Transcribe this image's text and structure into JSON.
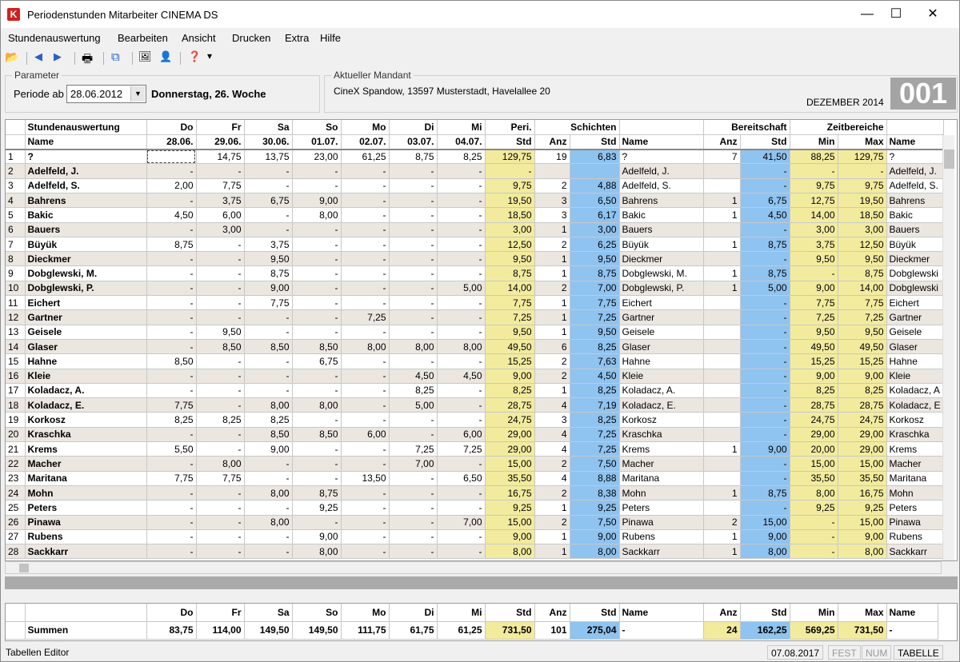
{
  "window": {
    "title": "Periodenstunden Mitarbeiter CINEMA DS",
    "app_icon": "K",
    "minimize": "—",
    "maximize": "☐",
    "close": "✕"
  },
  "menu": [
    "Stundenauswertung",
    "Bearbeiten",
    "Ansicht",
    "Drucken",
    "Extra",
    "Hilfe"
  ],
  "toolbar": [
    {
      "name": "open-folder-icon",
      "glyph": "📂"
    },
    {
      "name": "back-arrow-icon",
      "glyph": "◀"
    },
    {
      "name": "forward-arrow-icon",
      "glyph": "▶"
    },
    {
      "name": "print-icon",
      "glyph": "🖶"
    },
    {
      "name": "copy-icon",
      "glyph": "⧉"
    },
    {
      "name": "picture-icon",
      "glyph": "🖼"
    },
    {
      "name": "user-icon",
      "glyph": "👤"
    },
    {
      "name": "help-icon",
      "glyph": "❓"
    },
    {
      "name": "dropdown-arrow-icon",
      "glyph": "▾"
    }
  ],
  "parameter": {
    "legend": "Parameter",
    "periode_label": "Periode ab",
    "periode_value": "28.06.2012",
    "periode_info": "Donnerstag, 26. Woche"
  },
  "mandant": {
    "legend": "Aktueller Mandant",
    "address": "CineX Spandow, 13597 Musterstadt, Havelallee 20",
    "month": "DEZEMBER 2014",
    "number": "001"
  },
  "grid": {
    "group_headers": [
      "Stundenauswertung",
      "Do",
      "Fr",
      "Sa",
      "So",
      "Mo",
      "Di",
      "Mi",
      "Peri.",
      "Schichten",
      "",
      "Bereitschaft",
      "Zeitbereiche",
      ""
    ],
    "columns": [
      "",
      "Name",
      "28.06.",
      "29.06.",
      "30.06.",
      "01.07.",
      "02.07.",
      "03.07.",
      "04.07.",
      "Std",
      "Anz",
      "Std",
      "Name",
      "Anz",
      "Std",
      "Min",
      "Max",
      "Name"
    ],
    "rows": [
      [
        "1",
        "?",
        "",
        "14,75",
        "13,75",
        "23,00",
        "61,25",
        "8,75",
        "8,25",
        "129,75",
        "19",
        "6,83",
        "?",
        "7",
        "41,50",
        "88,25",
        "129,75",
        "?"
      ],
      [
        "2",
        "Adelfeld, J.",
        "-",
        "-",
        "-",
        "-",
        "-",
        "-",
        "-",
        "-",
        "",
        "",
        "Adelfeld, J.",
        "",
        "-",
        "-",
        "-",
        "Adelfeld, J."
      ],
      [
        "3",
        "Adelfeld, S.",
        "2,00",
        "7,75",
        "-",
        "-",
        "-",
        "-",
        "-",
        "9,75",
        "2",
        "4,88",
        "Adelfeld, S.",
        "",
        "-",
        "9,75",
        "9,75",
        "Adelfeld, S."
      ],
      [
        "4",
        "Bahrens",
        "-",
        "3,75",
        "6,75",
        "9,00",
        "-",
        "-",
        "-",
        "19,50",
        "3",
        "6,50",
        "Bahrens",
        "1",
        "6,75",
        "12,75",
        "19,50",
        "Bahrens"
      ],
      [
        "5",
        "Bakic",
        "4,50",
        "6,00",
        "-",
        "8,00",
        "-",
        "-",
        "-",
        "18,50",
        "3",
        "6,17",
        "Bakic",
        "1",
        "4,50",
        "14,00",
        "18,50",
        "Bakic"
      ],
      [
        "6",
        "Bauers",
        "-",
        "3,00",
        "-",
        "-",
        "-",
        "-",
        "-",
        "3,00",
        "1",
        "3,00",
        "Bauers",
        "",
        "-",
        "3,00",
        "3,00",
        "Bauers"
      ],
      [
        "7",
        "Büyük",
        "8,75",
        "-",
        "3,75",
        "-",
        "-",
        "-",
        "-",
        "12,50",
        "2",
        "6,25",
        "Büyük",
        "1",
        "8,75",
        "3,75",
        "12,50",
        "Büyük"
      ],
      [
        "8",
        "Dieckmer",
        "-",
        "-",
        "9,50",
        "-",
        "-",
        "-",
        "-",
        "9,50",
        "1",
        "9,50",
        "Dieckmer",
        "",
        "-",
        "9,50",
        "9,50",
        "Dieckmer"
      ],
      [
        "9",
        "Dobglewski, M.",
        "-",
        "-",
        "8,75",
        "-",
        "-",
        "-",
        "-",
        "8,75",
        "1",
        "8,75",
        "Dobglewski, M.",
        "1",
        "8,75",
        "-",
        "8,75",
        "Dobglewski"
      ],
      [
        "10",
        "Dobglewski, P.",
        "-",
        "-",
        "9,00",
        "-",
        "-",
        "-",
        "5,00",
        "14,00",
        "2",
        "7,00",
        "Dobglewski, P.",
        "1",
        "5,00",
        "9,00",
        "14,00",
        "Dobglewski"
      ],
      [
        "11",
        "Eichert",
        "-",
        "-",
        "7,75",
        "-",
        "-",
        "-",
        "-",
        "7,75",
        "1",
        "7,75",
        "Eichert",
        "",
        "-",
        "7,75",
        "7,75",
        "Eichert"
      ],
      [
        "12",
        "Gartner",
        "-",
        "-",
        "-",
        "-",
        "7,25",
        "-",
        "-",
        "7,25",
        "1",
        "7,25",
        "Gartner",
        "",
        "-",
        "7,25",
        "7,25",
        "Gartner"
      ],
      [
        "13",
        "Geisele",
        "-",
        "9,50",
        "-",
        "-",
        "-",
        "-",
        "-",
        "9,50",
        "1",
        "9,50",
        "Geisele",
        "",
        "-",
        "9,50",
        "9,50",
        "Geisele"
      ],
      [
        "14",
        "Glaser",
        "-",
        "8,50",
        "8,50",
        "8,50",
        "8,00",
        "8,00",
        "8,00",
        "49,50",
        "6",
        "8,25",
        "Glaser",
        "",
        "-",
        "49,50",
        "49,50",
        "Glaser"
      ],
      [
        "15",
        "Hahne",
        "8,50",
        "-",
        "-",
        "6,75",
        "-",
        "-",
        "-",
        "15,25",
        "2",
        "7,63",
        "Hahne",
        "",
        "-",
        "15,25",
        "15,25",
        "Hahne"
      ],
      [
        "16",
        "Kleie",
        "-",
        "-",
        "-",
        "-",
        "-",
        "4,50",
        "4,50",
        "9,00",
        "2",
        "4,50",
        "Kleie",
        "",
        "-",
        "9,00",
        "9,00",
        "Kleie"
      ],
      [
        "17",
        "Koladacz, A.",
        "-",
        "-",
        "-",
        "-",
        "-",
        "8,25",
        "-",
        "8,25",
        "1",
        "8,25",
        "Koladacz, A.",
        "",
        "-",
        "8,25",
        "8,25",
        "Koladacz, A"
      ],
      [
        "18",
        "Koladacz, E.",
        "7,75",
        "-",
        "8,00",
        "8,00",
        "-",
        "5,00",
        "-",
        "28,75",
        "4",
        "7,19",
        "Koladacz, E.",
        "",
        "-",
        "28,75",
        "28,75",
        "Koladacz, E"
      ],
      [
        "19",
        "Korkosz",
        "8,25",
        "8,25",
        "8,25",
        "-",
        "-",
        "-",
        "-",
        "24,75",
        "3",
        "8,25",
        "Korkosz",
        "",
        "-",
        "24,75",
        "24,75",
        "Korkosz"
      ],
      [
        "20",
        "Kraschka",
        "-",
        "-",
        "8,50",
        "8,50",
        "6,00",
        "-",
        "6,00",
        "29,00",
        "4",
        "7,25",
        "Kraschka",
        "",
        "-",
        "29,00",
        "29,00",
        "Kraschka"
      ],
      [
        "21",
        "Krems",
        "5,50",
        "-",
        "9,00",
        "-",
        "-",
        "7,25",
        "7,25",
        "29,00",
        "4",
        "7,25",
        "Krems",
        "1",
        "9,00",
        "20,00",
        "29,00",
        "Krems"
      ],
      [
        "22",
        "Macher",
        "-",
        "8,00",
        "-",
        "-",
        "-",
        "7,00",
        "-",
        "15,00",
        "2",
        "7,50",
        "Macher",
        "",
        "-",
        "15,00",
        "15,00",
        "Macher"
      ],
      [
        "23",
        "Maritana",
        "7,75",
        "7,75",
        "-",
        "-",
        "13,50",
        "-",
        "6,50",
        "35,50",
        "4",
        "8,88",
        "Maritana",
        "",
        "-",
        "35,50",
        "35,50",
        "Maritana"
      ],
      [
        "24",
        "Mohn",
        "-",
        "-",
        "8,00",
        "8,75",
        "-",
        "-",
        "-",
        "16,75",
        "2",
        "8,38",
        "Mohn",
        "1",
        "8,75",
        "8,00",
        "16,75",
        "Mohn"
      ],
      [
        "25",
        "Peters",
        "-",
        "-",
        "-",
        "9,25",
        "-",
        "-",
        "-",
        "9,25",
        "1",
        "9,25",
        "Peters",
        "",
        "-",
        "9,25",
        "9,25",
        "Peters"
      ],
      [
        "26",
        "Pinawa",
        "-",
        "-",
        "8,00",
        "-",
        "-",
        "-",
        "7,00",
        "15,00",
        "2",
        "7,50",
        "Pinawa",
        "2",
        "15,00",
        "-",
        "15,00",
        "Pinawa"
      ],
      [
        "27",
        "Rubens",
        "-",
        "-",
        "-",
        "9,00",
        "-",
        "-",
        "-",
        "9,00",
        "1",
        "9,00",
        "Rubens",
        "1",
        "9,00",
        "-",
        "9,00",
        "Rubens"
      ],
      [
        "28",
        "Sackkarr",
        "-",
        "-",
        "-",
        "8,00",
        "-",
        "-",
        "-",
        "8,00",
        "1",
        "8,00",
        "Sackkarr",
        "1",
        "8,00",
        "-",
        "8,00",
        "Sackkarr"
      ]
    ]
  },
  "sums": {
    "header": [
      "",
      "",
      "Do",
      "Fr",
      "Sa",
      "So",
      "Mo",
      "Di",
      "Mi",
      "Std",
      "Anz",
      "Std",
      "Name",
      "Anz",
      "Std",
      "Min",
      "Max",
      "Name"
    ],
    "row": [
      "",
      "Summen",
      "83,75",
      "114,00",
      "149,50",
      "149,50",
      "111,75",
      "61,75",
      "61,25",
      "731,50",
      "101",
      "275,04",
      "-",
      "24",
      "162,25",
      "569,25",
      "731,50",
      "-"
    ]
  },
  "status": {
    "left": "Tabellen Editor",
    "date": "07.08.2017",
    "fest": "FEST",
    "num": "NUM",
    "tabelle": "TABELLE"
  },
  "colors": {
    "yellow": "#f2eb9e",
    "blue": "#8fc3f0",
    "alt_row": "#ece6e1",
    "badge": "#a4a4a4"
  }
}
